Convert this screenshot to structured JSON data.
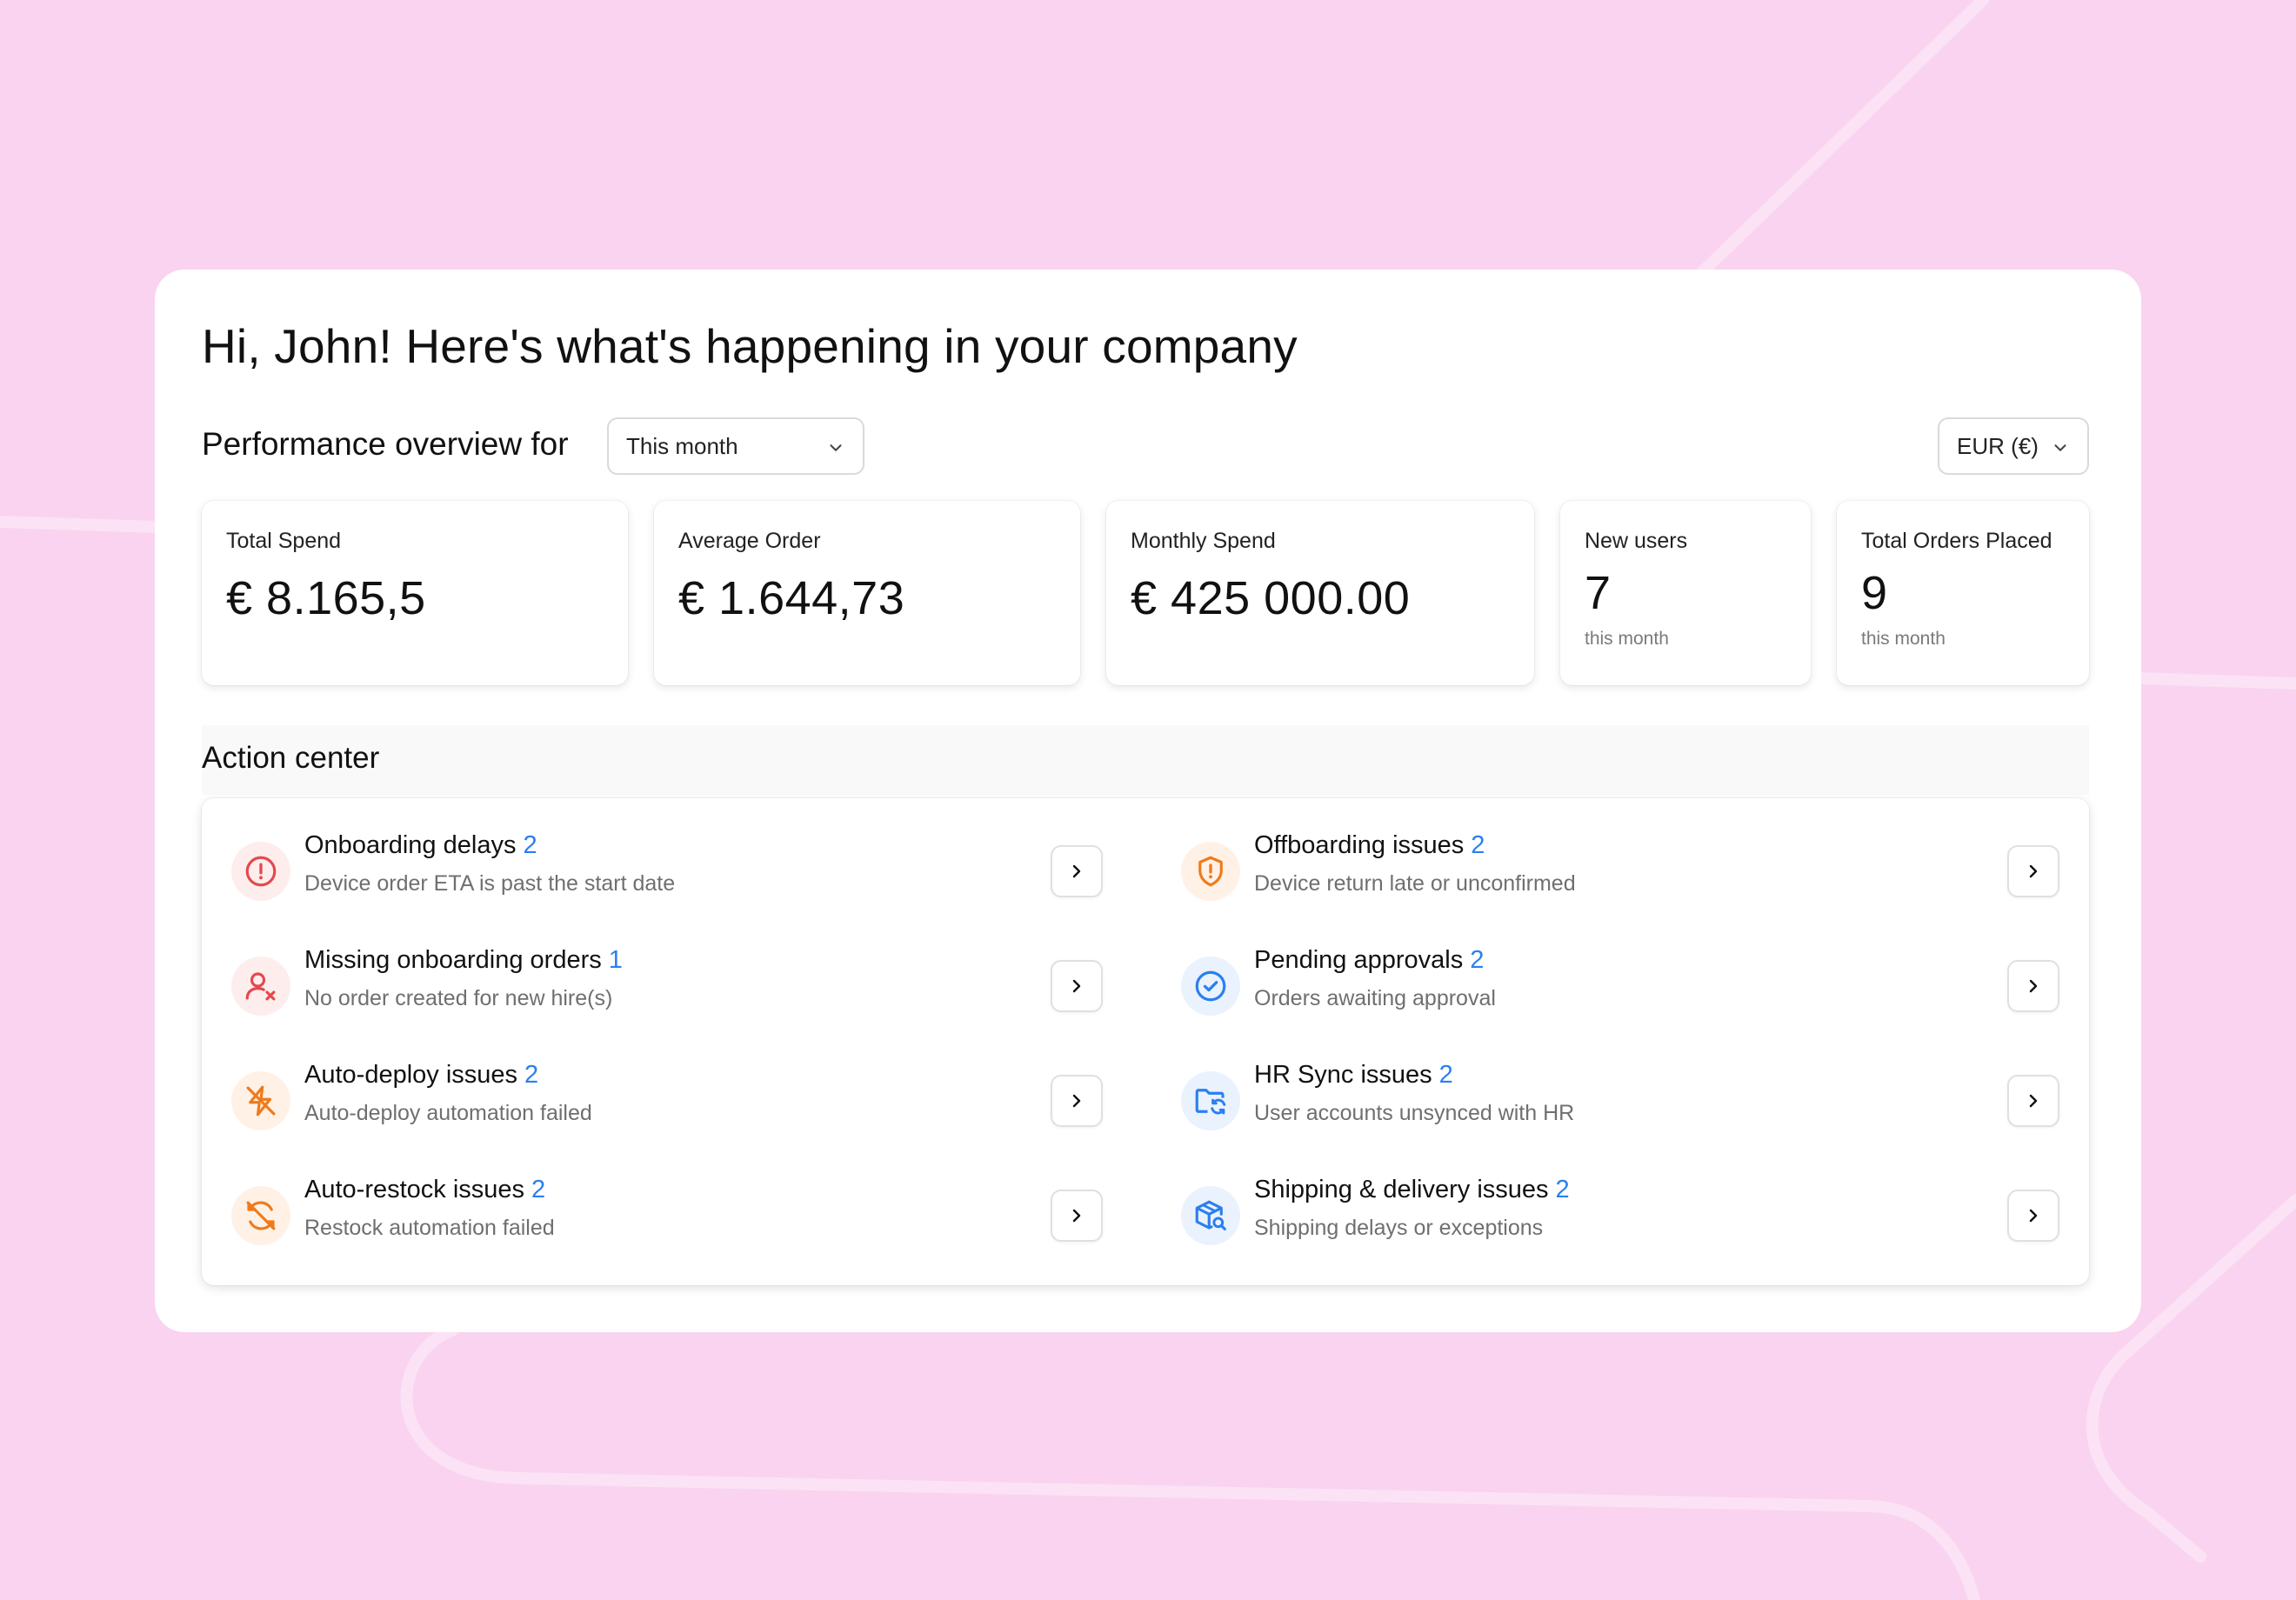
{
  "greeting": "Hi, John! Here's what's happening in your company",
  "performance": {
    "label": "Performance overview for",
    "period_value": "This month",
    "currency_value": "EUR (€)"
  },
  "stats": [
    {
      "label": "Total Spend",
      "value": "€ 8.165,5",
      "sub": ""
    },
    {
      "label": "Average Order",
      "value": "€ 1.644,73",
      "sub": ""
    },
    {
      "label": "Monthly Spend",
      "value": "€ 425 000.00",
      "sub": ""
    },
    {
      "label": "New users",
      "value": "7",
      "sub": "this month"
    },
    {
      "label": "Total Orders Placed",
      "value": "9",
      "sub": "this month"
    }
  ],
  "action_center": {
    "title": "Action center",
    "items": [
      {
        "title": "Onboarding delays",
        "count": "2",
        "subtitle": "Device order ETA is past the start date",
        "icon": "alert-circle-icon",
        "tone": "red"
      },
      {
        "title": "Missing onboarding orders",
        "count": "1",
        "subtitle": "No order created for new hire(s)",
        "icon": "user-x-icon",
        "tone": "red"
      },
      {
        "title": "Auto-deploy issues",
        "count": "2",
        "subtitle": "Auto-deploy automation failed",
        "icon": "zap-off-icon",
        "tone": "orange"
      },
      {
        "title": "Auto-restock issues",
        "count": "2",
        "subtitle": "Restock automation failed",
        "icon": "refresh-off-icon",
        "tone": "orange"
      },
      {
        "title": "Offboarding issues",
        "count": "2",
        "subtitle": "Device return late or unconfirmed",
        "icon": "shield-alert-icon",
        "tone": "orange"
      },
      {
        "title": "Pending approvals",
        "count": "2",
        "subtitle": "Orders awaiting approval",
        "icon": "check-circle-icon",
        "tone": "blue"
      },
      {
        "title": "HR Sync issues",
        "count": "2",
        "subtitle": "User accounts unsynced with HR",
        "icon": "folder-sync-icon",
        "tone": "blue"
      },
      {
        "title": "Shipping & delivery issues",
        "count": "2",
        "subtitle": "Shipping delays or exceptions",
        "icon": "package-search-icon",
        "tone": "blue"
      }
    ]
  },
  "colors": {
    "background": "#f9d3ef",
    "count_accent": "#2a7ff0",
    "red": "#e5484d",
    "orange": "#f07a1a",
    "blue": "#2a7ff0"
  }
}
